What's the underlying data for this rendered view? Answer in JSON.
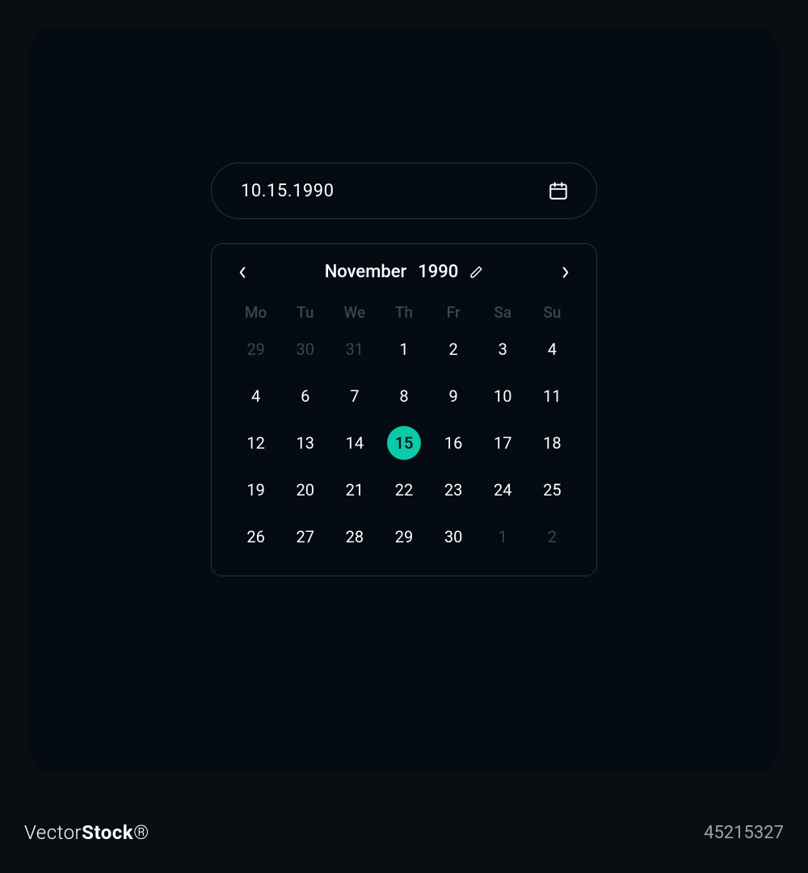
{
  "colors": {
    "accent": "#0bc9a9",
    "bg": "#0a0d12",
    "card": "#040b12",
    "border": "#2a3440",
    "text": "#ffffff",
    "muted": "#3a4550"
  },
  "input": {
    "value": "10.15.1990",
    "icon": "calendar-icon"
  },
  "calendar": {
    "month": "November",
    "year": "1990",
    "weekdays": [
      "Mo",
      "Tu",
      "We",
      "Th",
      "Fr",
      "Sa",
      "Su"
    ],
    "days": [
      {
        "n": "29",
        "muted": true,
        "selected": false
      },
      {
        "n": "30",
        "muted": true,
        "selected": false
      },
      {
        "n": "31",
        "muted": true,
        "selected": false
      },
      {
        "n": "1",
        "muted": false,
        "selected": false
      },
      {
        "n": "2",
        "muted": false,
        "selected": false
      },
      {
        "n": "3",
        "muted": false,
        "selected": false
      },
      {
        "n": "4",
        "muted": false,
        "selected": false
      },
      {
        "n": "4",
        "muted": false,
        "selected": false
      },
      {
        "n": "6",
        "muted": false,
        "selected": false
      },
      {
        "n": "7",
        "muted": false,
        "selected": false
      },
      {
        "n": "8",
        "muted": false,
        "selected": false
      },
      {
        "n": "9",
        "muted": false,
        "selected": false
      },
      {
        "n": "10",
        "muted": false,
        "selected": false
      },
      {
        "n": "11",
        "muted": false,
        "selected": false
      },
      {
        "n": "12",
        "muted": false,
        "selected": false
      },
      {
        "n": "13",
        "muted": false,
        "selected": false
      },
      {
        "n": "14",
        "muted": false,
        "selected": false
      },
      {
        "n": "15",
        "muted": false,
        "selected": true
      },
      {
        "n": "16",
        "muted": false,
        "selected": false
      },
      {
        "n": "17",
        "muted": false,
        "selected": false
      },
      {
        "n": "18",
        "muted": false,
        "selected": false
      },
      {
        "n": "19",
        "muted": false,
        "selected": false
      },
      {
        "n": "20",
        "muted": false,
        "selected": false
      },
      {
        "n": "21",
        "muted": false,
        "selected": false
      },
      {
        "n": "22",
        "muted": false,
        "selected": false
      },
      {
        "n": "23",
        "muted": false,
        "selected": false
      },
      {
        "n": "24",
        "muted": false,
        "selected": false
      },
      {
        "n": "25",
        "muted": false,
        "selected": false
      },
      {
        "n": "26",
        "muted": false,
        "selected": false
      },
      {
        "n": "27",
        "muted": false,
        "selected": false
      },
      {
        "n": "28",
        "muted": false,
        "selected": false
      },
      {
        "n": "29",
        "muted": false,
        "selected": false
      },
      {
        "n": "30",
        "muted": false,
        "selected": false
      },
      {
        "n": "1",
        "muted": true,
        "selected": false
      },
      {
        "n": "2",
        "muted": true,
        "selected": false
      }
    ]
  },
  "footer": {
    "brand_prefix": "Vector",
    "brand_suffix": "Stock",
    "brand_reg": "®",
    "image_id": "45215327"
  }
}
